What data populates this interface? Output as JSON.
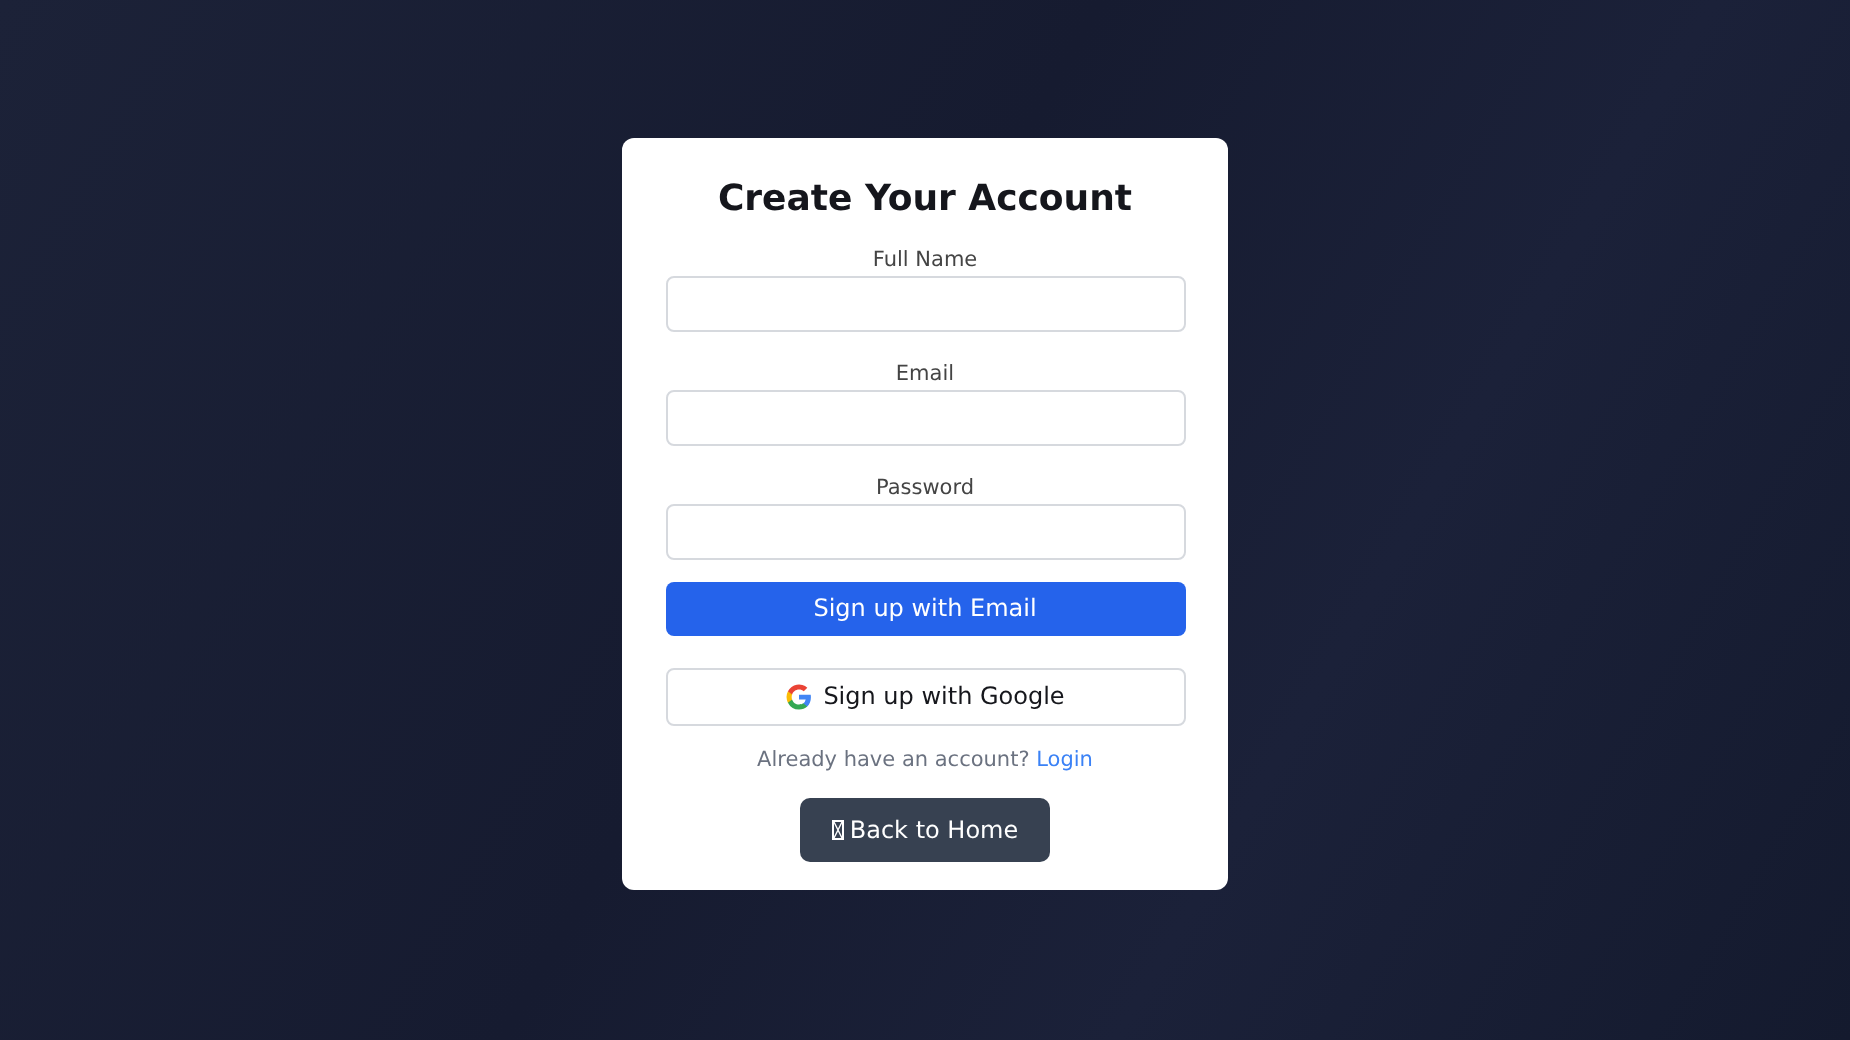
{
  "title": "Create Your Account",
  "fields": [
    {
      "label": "Full Name"
    },
    {
      "label": "Email"
    },
    {
      "label": "Password"
    }
  ],
  "primary_button": "Sign up with Email",
  "google_button": "Sign up with Google",
  "login_prompt": {
    "text": "Already have an account?",
    "link": "Login"
  },
  "back_button": "Back to Home"
}
